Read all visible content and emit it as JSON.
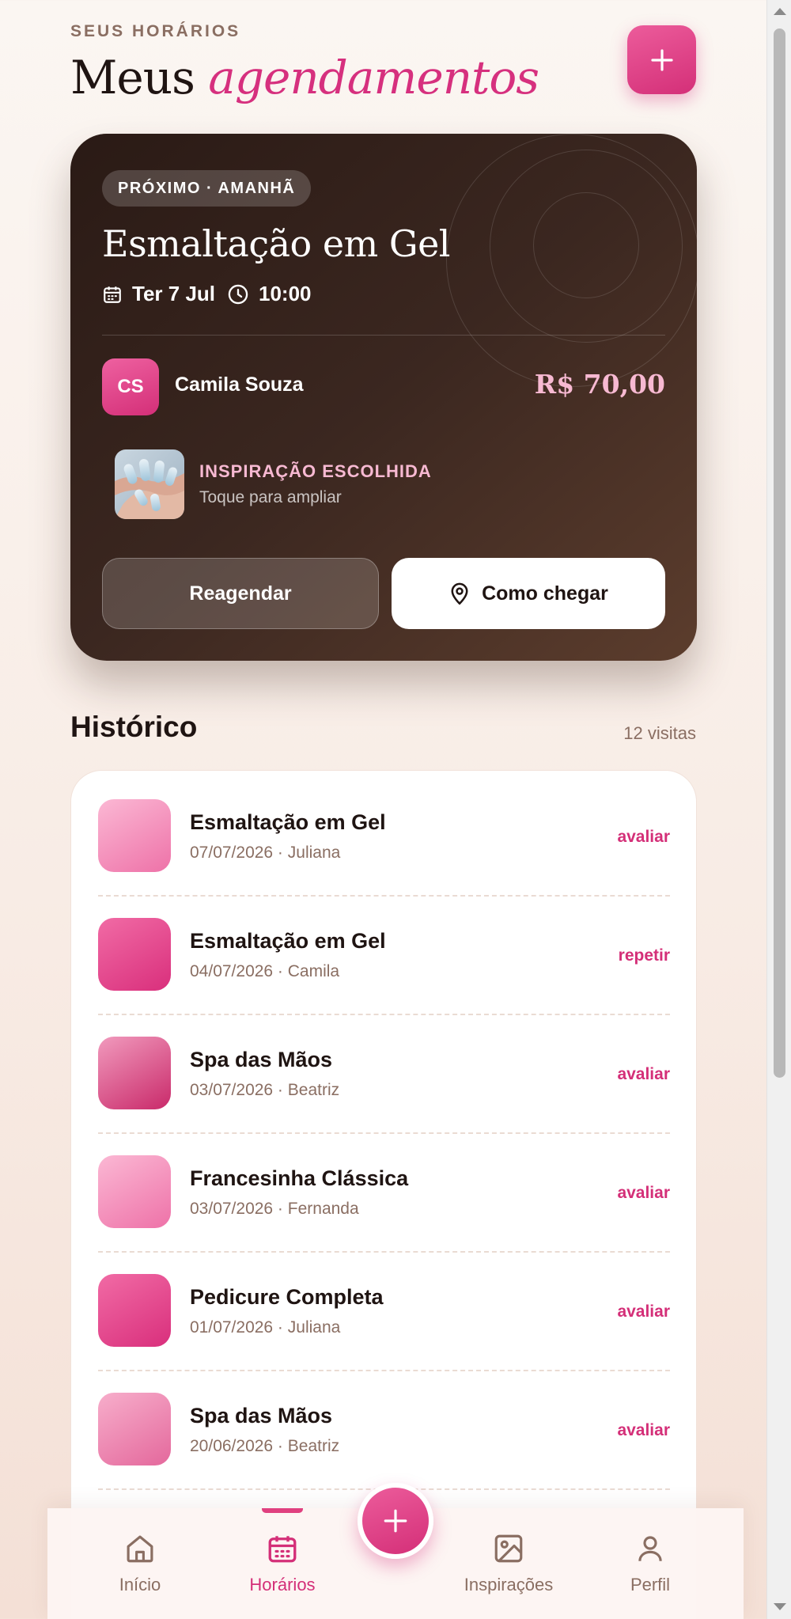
{
  "header": {
    "eyebrow": "SEUS HORÁRIOS",
    "title_plain": "Meus",
    "title_accent": "agendamentos",
    "add_icon": "plus-icon"
  },
  "next": {
    "badge": "PRÓXIMO · AMANHÃ",
    "service": "Esmaltação em Gel",
    "date": "Ter 7 Jul",
    "time": "10:00",
    "professional_initials": "CS",
    "professional_name": "Camila Souza",
    "price": "R$ 70,00",
    "inspiration_label": "INSPIRAÇÃO ESCOLHIDA",
    "inspiration_hint": "Toque para ampliar",
    "reschedule_label": "Reagendar",
    "directions_label": "Como chegar"
  },
  "history": {
    "title": "Histórico",
    "count": "12 visitas",
    "items": [
      {
        "name": "Esmaltação em Gel",
        "meta": "07/07/2026 · Juliana",
        "action": "avaliar"
      },
      {
        "name": "Esmaltação em Gel",
        "meta": "04/07/2026 · Camila",
        "action": "repetir"
      },
      {
        "name": "Spa das Mãos",
        "meta": "03/07/2026 · Beatriz",
        "action": "avaliar"
      },
      {
        "name": "Francesinha Clássica",
        "meta": "03/07/2026 · Fernanda",
        "action": "avaliar"
      },
      {
        "name": "Pedicure Completa",
        "meta": "01/07/2026 · Juliana",
        "action": "avaliar"
      },
      {
        "name": "Spa das Mãos",
        "meta": "20/06/2026 · Beatriz",
        "action": "avaliar"
      }
    ]
  },
  "nav": {
    "items": [
      {
        "label": "Início",
        "icon": "home-icon"
      },
      {
        "label": "Horários",
        "icon": "calendar-icon"
      },
      {
        "label": "Inspirações",
        "icon": "image-icon"
      },
      {
        "label": "Perfil",
        "icon": "user-icon"
      }
    ],
    "active": "Horários"
  },
  "colors": {
    "accent": "#d42f78",
    "card_dark": "#2a1a15",
    "muted_text": "#8a6e62"
  }
}
